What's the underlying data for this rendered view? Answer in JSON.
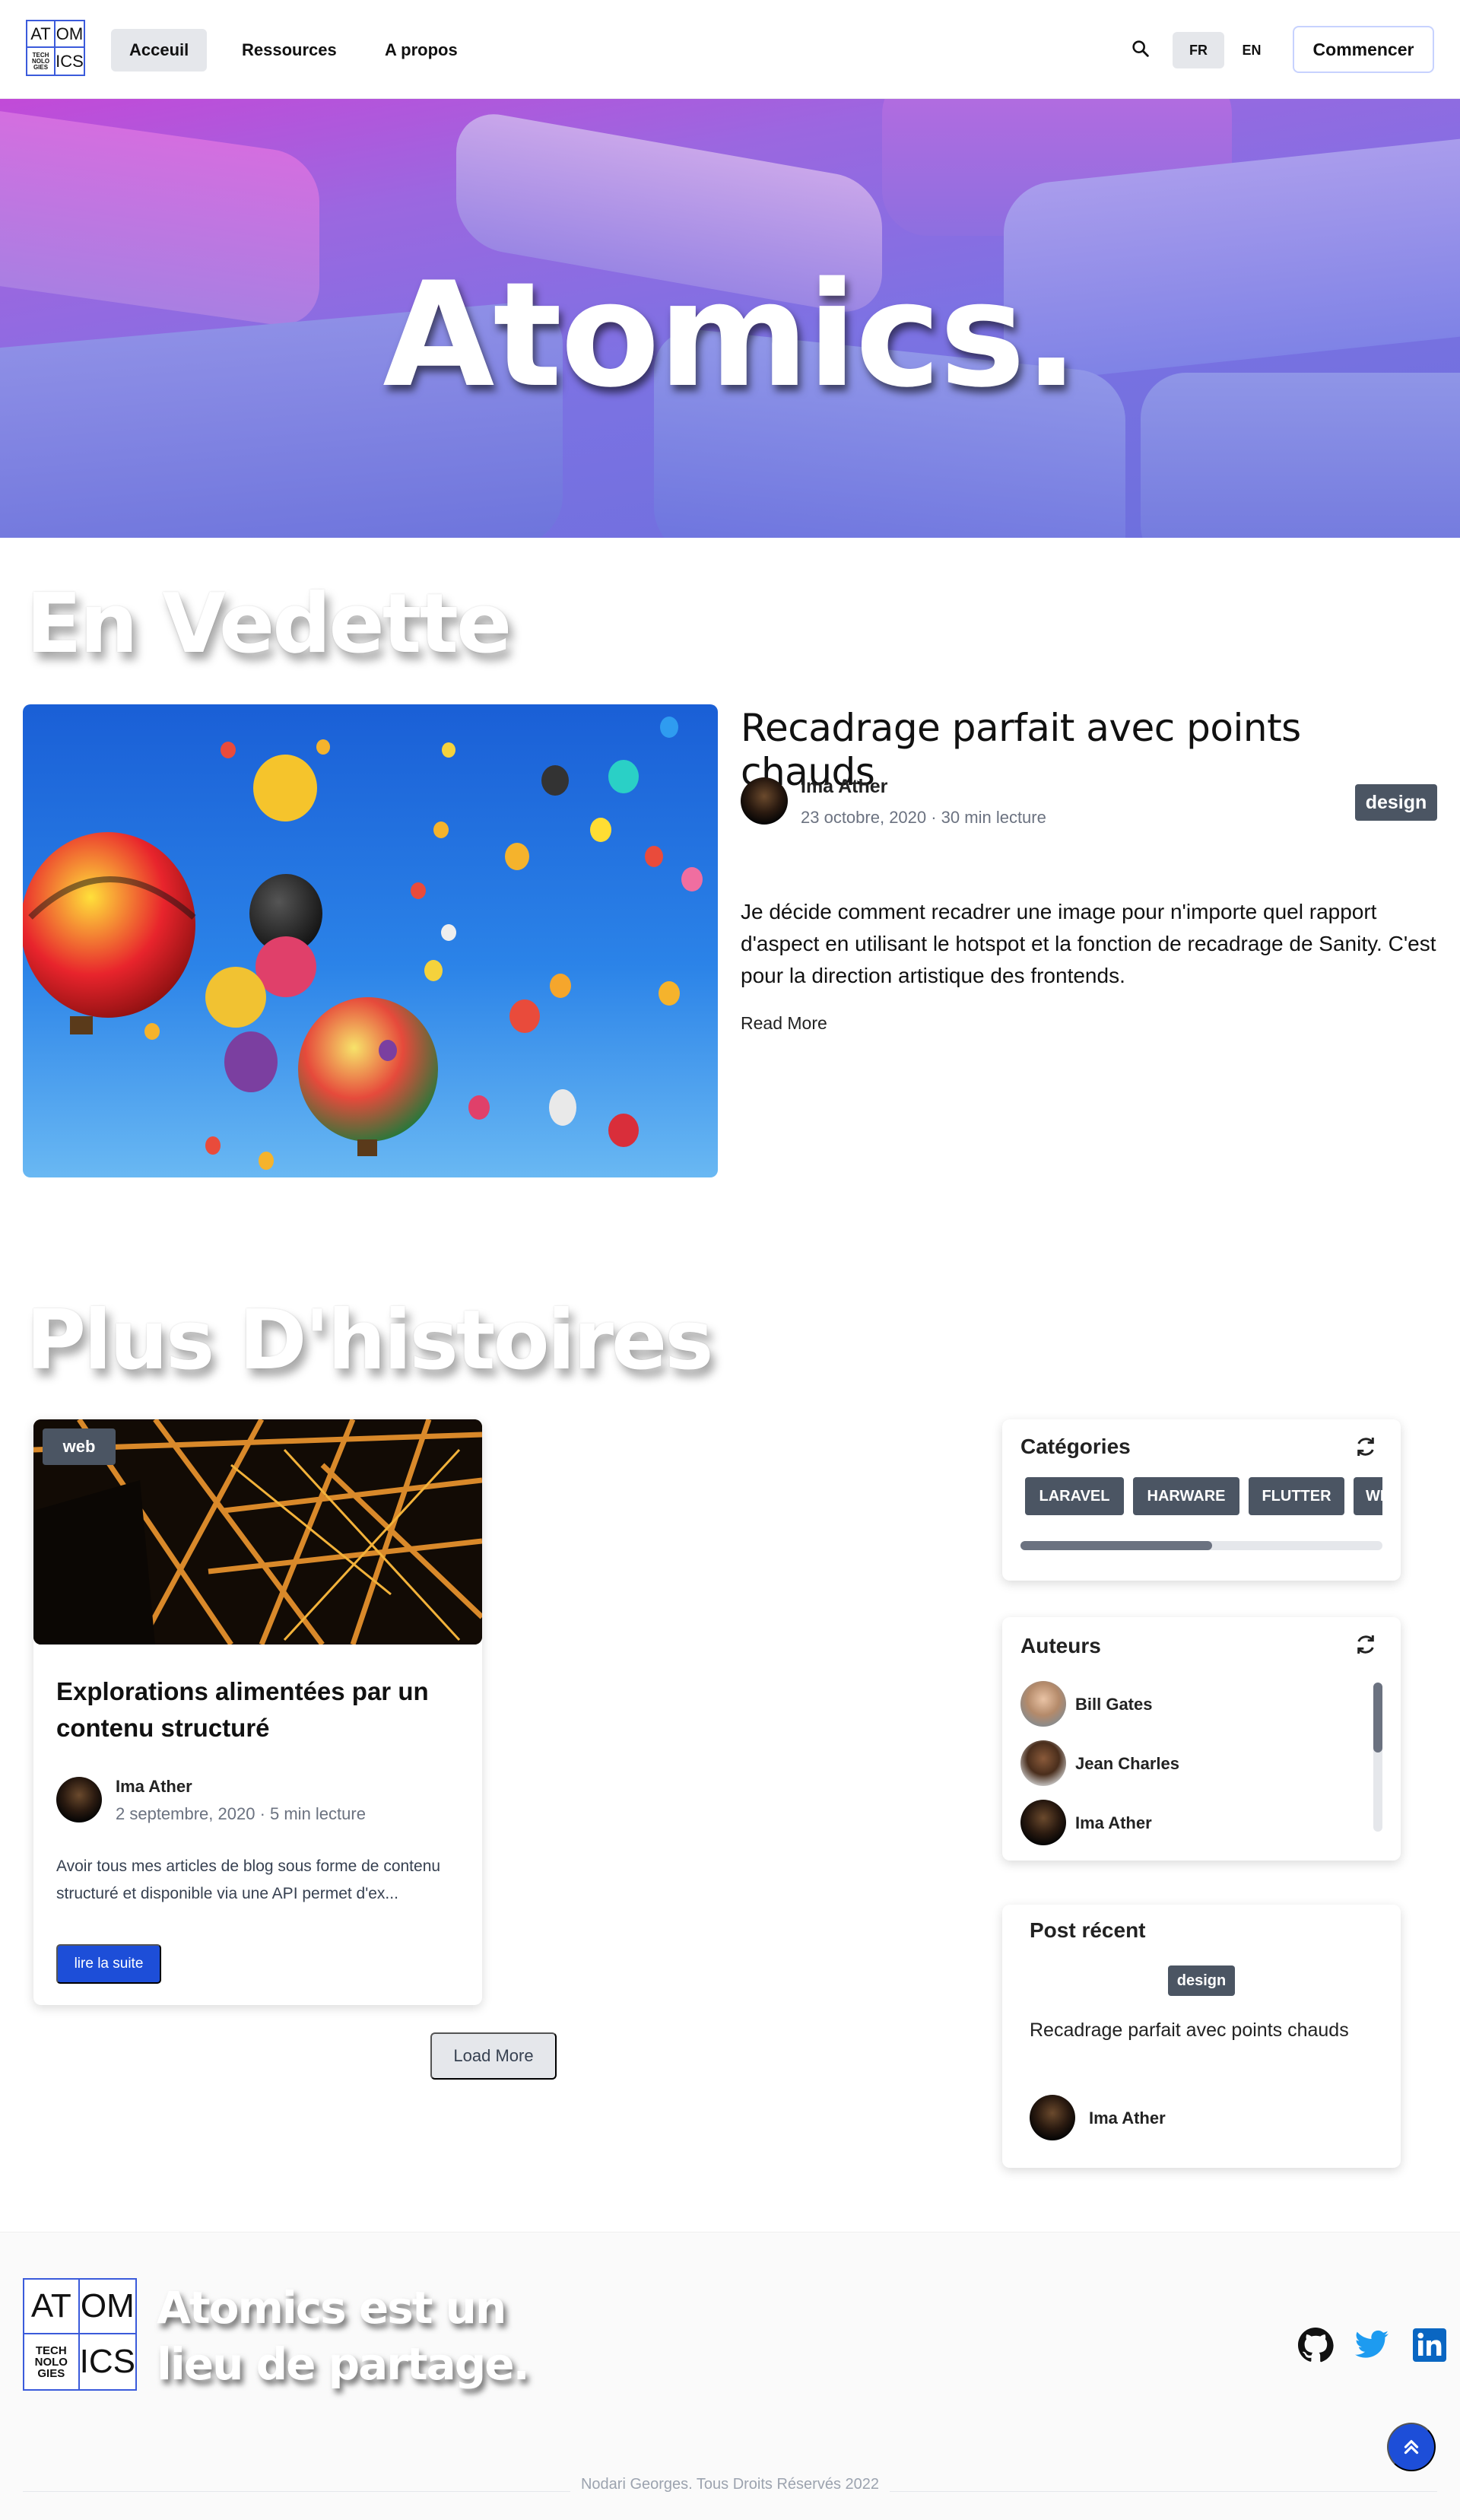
{
  "nav": {
    "logo": {
      "tl": "AT",
      "tr": "OM",
      "bl": "TECH NOLO GIES",
      "br": "ICS"
    },
    "links": [
      "Acceuil",
      "Ressources",
      "A propos"
    ],
    "search_icon": "search-icon",
    "languages": [
      "FR",
      "EN"
    ],
    "active_language": "FR",
    "cta": "Commencer"
  },
  "hero": {
    "title": "Atomics."
  },
  "featured": {
    "section_title": "En Vedette",
    "title": "Recadrage parfait avec points chauds",
    "author": "Ima Ather",
    "meta": "23 octobre, 2020 · 30 min lecture",
    "tag": "design",
    "excerpt": "Je décide comment recadrer une image pour n'importe quel rapport d'aspect en utilisant le hotspot et la fonction de recadrage de Sanity. C'est pour la direction artistique des frontends.",
    "read_more": "Read More"
  },
  "stories": {
    "section_title": "Plus D'histoires",
    "card": {
      "tag": "web",
      "title": "Explorations alimentées par un contenu structuré",
      "author": "Ima Ather",
      "meta": "2 septembre, 2020 · 5 min lecture",
      "excerpt": "Avoir tous mes articles de blog sous forme de contenu structuré et disponible via une API permet d'ex...",
      "button": "lire la suite"
    },
    "load_more": "Load More"
  },
  "sidebar": {
    "categories": {
      "title": "Catégories",
      "chips": [
        "LARAVEL",
        "HARWARE",
        "FLUTTER",
        "WE"
      ],
      "scroll_progress": 0.53
    },
    "authors": {
      "title": "Auteurs",
      "items": [
        "Bill Gates",
        "Jean Charles",
        "Ima Ather"
      ]
    },
    "recent": {
      "title": "Post récent",
      "tag": "design",
      "post_title": "Recadrage parfait avec points chauds",
      "author": "Ima Ather"
    }
  },
  "footer": {
    "logo": {
      "tl": "AT",
      "tr": "OM",
      "bl": "TECH NOLO GIES",
      "br": "ICS"
    },
    "tagline": "Atomics est un lieu de partage.",
    "socials": [
      "github-icon",
      "twitter-icon",
      "linkedin-icon"
    ],
    "copyright": "Nodari Georges. Tous Droits Réservés 2022"
  },
  "colors": {
    "accent": "#1d4ed8",
    "badge": "#4b5563",
    "logo_border": "#3b5bdb"
  }
}
